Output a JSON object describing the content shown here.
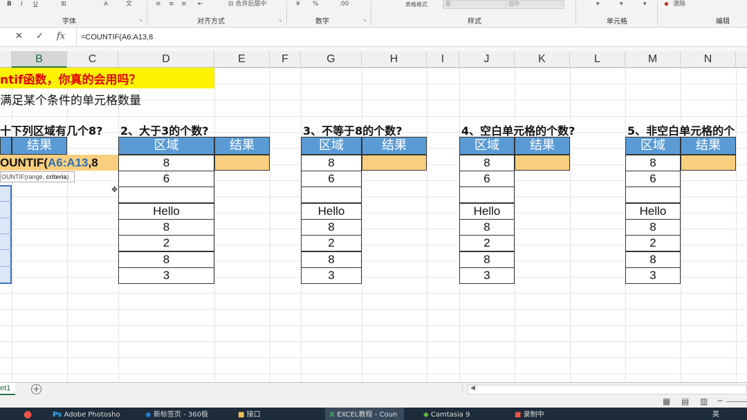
{
  "ribbon": {
    "groups": [
      "字体",
      "对齐方式",
      "数字",
      "样式",
      "单元格",
      "编辑"
    ],
    "merge_center": "合并后居中",
    "table_format": "表格格式",
    "style_bad": "差",
    "style_neutral": "适中",
    "clear": "清除"
  },
  "formula_bar": {
    "cancel": "✕",
    "enter": "✓",
    "fx": "fx",
    "formula": "=COUNTIF(A6:A13,8"
  },
  "columns": [
    "B",
    "C",
    "D",
    "E",
    "F",
    "G",
    "H",
    "I",
    "J",
    "K",
    "L",
    "M",
    "N"
  ],
  "sheet": {
    "title": "ntif函数，你真的会用吗？",
    "subtitle": "满足某个条件的单元格数量",
    "q1": "十下列区域有几个8?",
    "q2": "2、大于3的个数?",
    "q3": "3、不等于8的个数?",
    "q4": "4、空白单元格的个数?",
    "q5": "5、非空白单元格的个",
    "header_area": "区域",
    "header_result": "结果",
    "edit_cell_prefix": "OUNTIF(",
    "edit_cell_range": "A6:A13",
    "edit_cell_suffix": ",8",
    "tooltip_fn": "OUNTIF(range, ",
    "tooltip_arg": "criteria",
    "tooltip_end": ")",
    "values": [
      "8",
      "6",
      "",
      "Hello",
      "8",
      "2",
      "8",
      "3"
    ]
  },
  "tabs": {
    "sheet_tab": "et1",
    "add": "+"
  },
  "taskbar": {
    "items": [
      "Adobe Photosho",
      "新标签页 - 360极",
      "接口",
      "EXCEL教程 - Coun",
      "Camtasia 9",
      "录制中"
    ],
    "lang": "英"
  },
  "colors": {
    "title_bg": "#fff200",
    "title_fg": "#e10000",
    "header_bg": "#5b9bd5",
    "result_bg": "#f8cf7f",
    "range_ref": "#2f6db5"
  }
}
